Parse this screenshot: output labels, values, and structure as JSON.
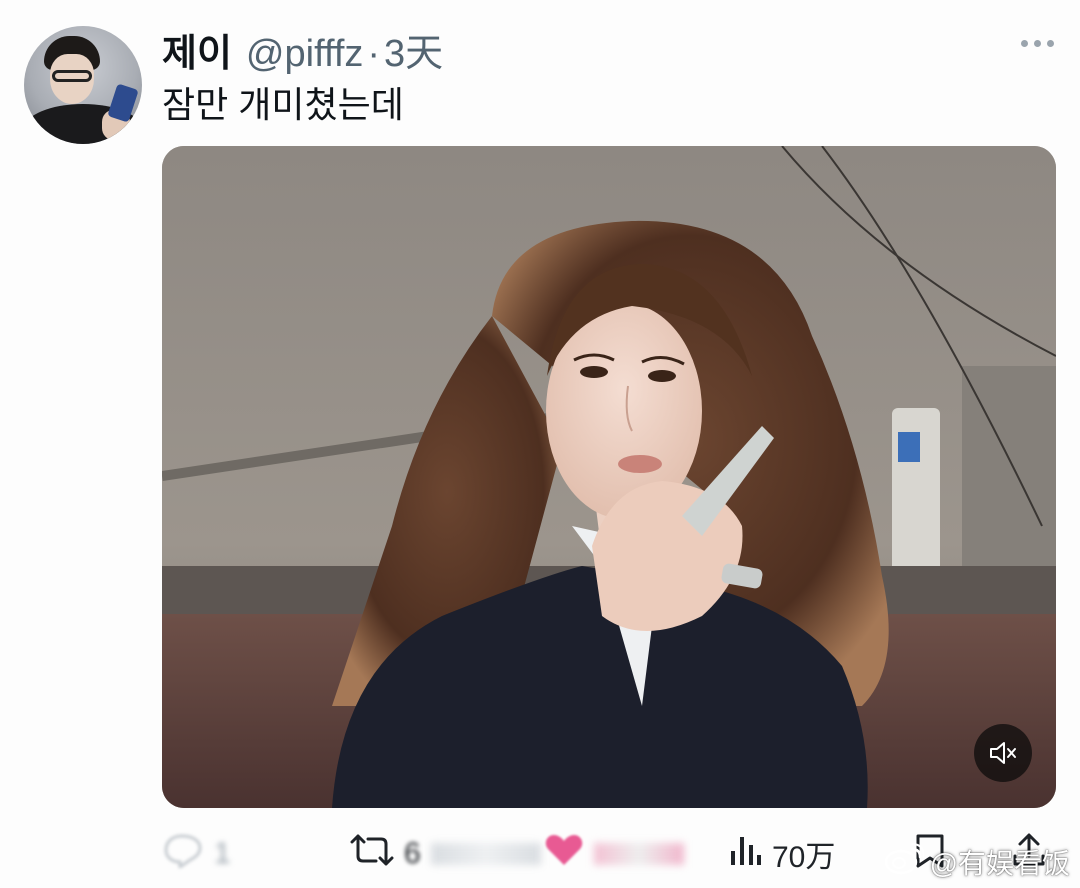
{
  "tweet": {
    "display_name": "제이",
    "handle": "@pifffz",
    "separator": "·",
    "time": "3天",
    "text": "잠만 개미쳤는데",
    "more_icon": "more-horizontal-icon"
  },
  "media": {
    "type": "video",
    "mute_icon": "volume-muted-icon"
  },
  "actions": {
    "reply_count": "1",
    "retweet_count": "6",
    "like_count": "",
    "views_count": "70万"
  },
  "watermark": {
    "text": "@有娱看饭"
  }
}
